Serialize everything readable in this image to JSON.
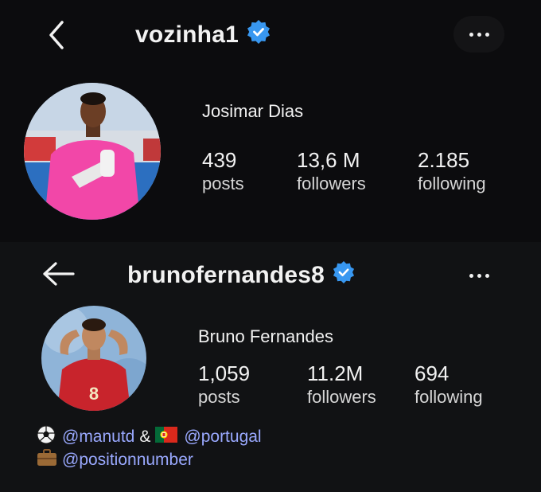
{
  "profile1": {
    "username": "vozinha1",
    "display_name": "Josimar Dias",
    "stats": [
      {
        "value": "439",
        "label": "posts"
      },
      {
        "value": "13,6 M",
        "label": "followers"
      },
      {
        "value": "2.185",
        "label": "following"
      }
    ]
  },
  "profile2": {
    "username": "brunofernandes8",
    "display_name": "Bruno Fernandes",
    "stats": [
      {
        "value": "1,059",
        "label": "posts"
      },
      {
        "value": "11.2M",
        "label": "followers"
      },
      {
        "value": "694",
        "label": "following"
      }
    ],
    "bio": {
      "line1_link1": "@manutd",
      "line1_sep": "&",
      "line1_link2": "@portugal",
      "line2_link": "@positionnumber"
    }
  },
  "icons": {
    "back": "chevron-left-icon",
    "back_arrow": "arrow-left-icon",
    "verified": "verified-badge-icon",
    "more": "more-dots-icon",
    "bio_icons": [
      "soccer-ball-icon",
      "portugal-flag-icon",
      "briefcase-icon"
    ]
  },
  "colors": {
    "verified": "#3897f0",
    "link": "#9aa9ff",
    "background": "#0b0b0d"
  }
}
